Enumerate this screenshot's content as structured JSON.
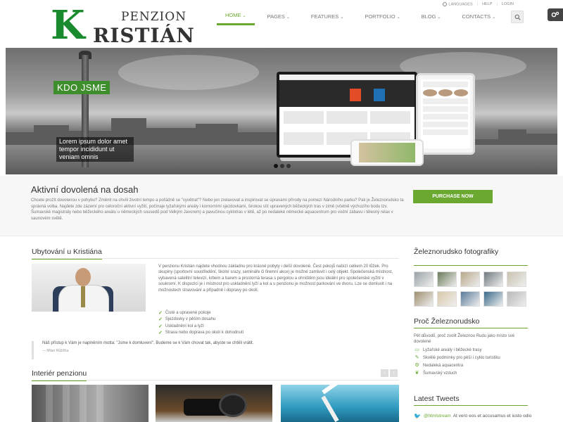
{
  "logo": {
    "k": "K",
    "line1": "PENZION",
    "line2": "RISTIÁN"
  },
  "topbar": {
    "languages": "LANGUAGES",
    "help": "HELP",
    "login": "LOGIN"
  },
  "nav": {
    "items": [
      {
        "label": "HOME",
        "active": true
      },
      {
        "label": "PAGES",
        "active": false
      },
      {
        "label": "FEATURES",
        "active": false
      },
      {
        "label": "PORTFOLIO",
        "active": false
      },
      {
        "label": "BLOG",
        "active": false
      },
      {
        "label": "CONTACTS",
        "active": false
      }
    ],
    "caret": "⌄"
  },
  "hero": {
    "title": "KDO JSME",
    "text": "Lorem ipsum dolor amet tempor incididunt ut veniam omnis"
  },
  "aktivni": {
    "title": "Aktivní dovolená na dosah",
    "text": "Chcete prožít dovolenou v pohybu? Změnit na chvíli životní tempo a pořádně se \"vyvětrat\"? Nebo jen zrelaxovat a inspirovat se úpravami přírody na pomezí Národního parku? Pak je Železnorudsko ta správná volba. Najdete zde zázemí pro celoroční aktivní vyžití, počínaje lyžařskými areály i komorními sjezdovkami, širokou sítí upravených běžeckých tras v zimě (včetně výchozího bodu tzv. Šumavské magistrály nebo běžeckého areálu u německých sousedů pod Velkým Javorem) a pavučinou cyklotras v létě, až po nedaleké německé aquacentrum pro vodní zábavu i tělesný relax v saunovém světě.",
    "button": "PURCHASE NOW"
  },
  "ubytovani": {
    "title": "Ubytování u Kristiána",
    "text": "V penzionu Kristián najdete vhodnou základnu pro krásné pobyty i delší dovolené. Čest pokojů nabízí celkem 20 lůžek. Pro skupiny (sportovní soustředění, školní srazy, semináře či firemní akce) je možné zamluvit i celý objekt. Společenská místnost, vybavená satelitní televizí, krbem a barem a prostorná terasa s pergolou a ohništěm jsou ideální pro společenské vyžití v soukromí. K dispozici je i místnost pro uskladnění lyží a kol a u penzionu je možnost parkování ve dvoru. Lze se domluvit i na možnostech stravování a případně i dopravy po okolí.",
    "checks": [
      "Čisté a upravené pokoje",
      "Sjezdovky v pěším dosahu",
      "Uskladnění kol a lyží",
      "Strava nebo doprava po okolí k dohodnutí"
    ]
  },
  "quote": {
    "text": "Náš přístup k Vám je naplněním motta: \"Jsme k domluvení\". Budeme se k Vám chovat tak, abyste se chtěli vrátit.",
    "author": "— Milan Růžička"
  },
  "interier": {
    "title": "Interiér penzionu",
    "prev": "‹",
    "next": "›"
  },
  "sidebar": {
    "foto_title": "Železnorudsko fotografiky",
    "thumb_colors": [
      "#9aa3a8",
      "#6b7b5a",
      "#b8a88a",
      "#707a80",
      "#c9c2b0",
      "#a09070",
      "#d8c8a8",
      "#5a7a9a",
      "#3a6a8a",
      "#b8b8b8"
    ],
    "proc_title": "Proč Železnorudsko",
    "proc_text": "Pět důvodů, proč zvolit Železnou Rudu jako místo své dovolené",
    "proc_items": [
      {
        "icon": "monitor-icon",
        "glyph": "▭",
        "label": "Lyžařské areály i běžecké trasy"
      },
      {
        "icon": "pencil-icon",
        "glyph": "✎",
        "label": "Skvělé podmínky pro pěší i cyklo turistiku"
      },
      {
        "icon": "gear-icon",
        "glyph": "⚙",
        "label": "Nedaleká aquacentra"
      },
      {
        "icon": "leaf-icon",
        "glyph": "❦",
        "label": "Šumavský vzduch"
      }
    ],
    "tweets_title": "Latest Tweets",
    "tweet_handle": "@htmlstream",
    "tweet_text": "At vero eos et accusamus et iusto odio"
  }
}
